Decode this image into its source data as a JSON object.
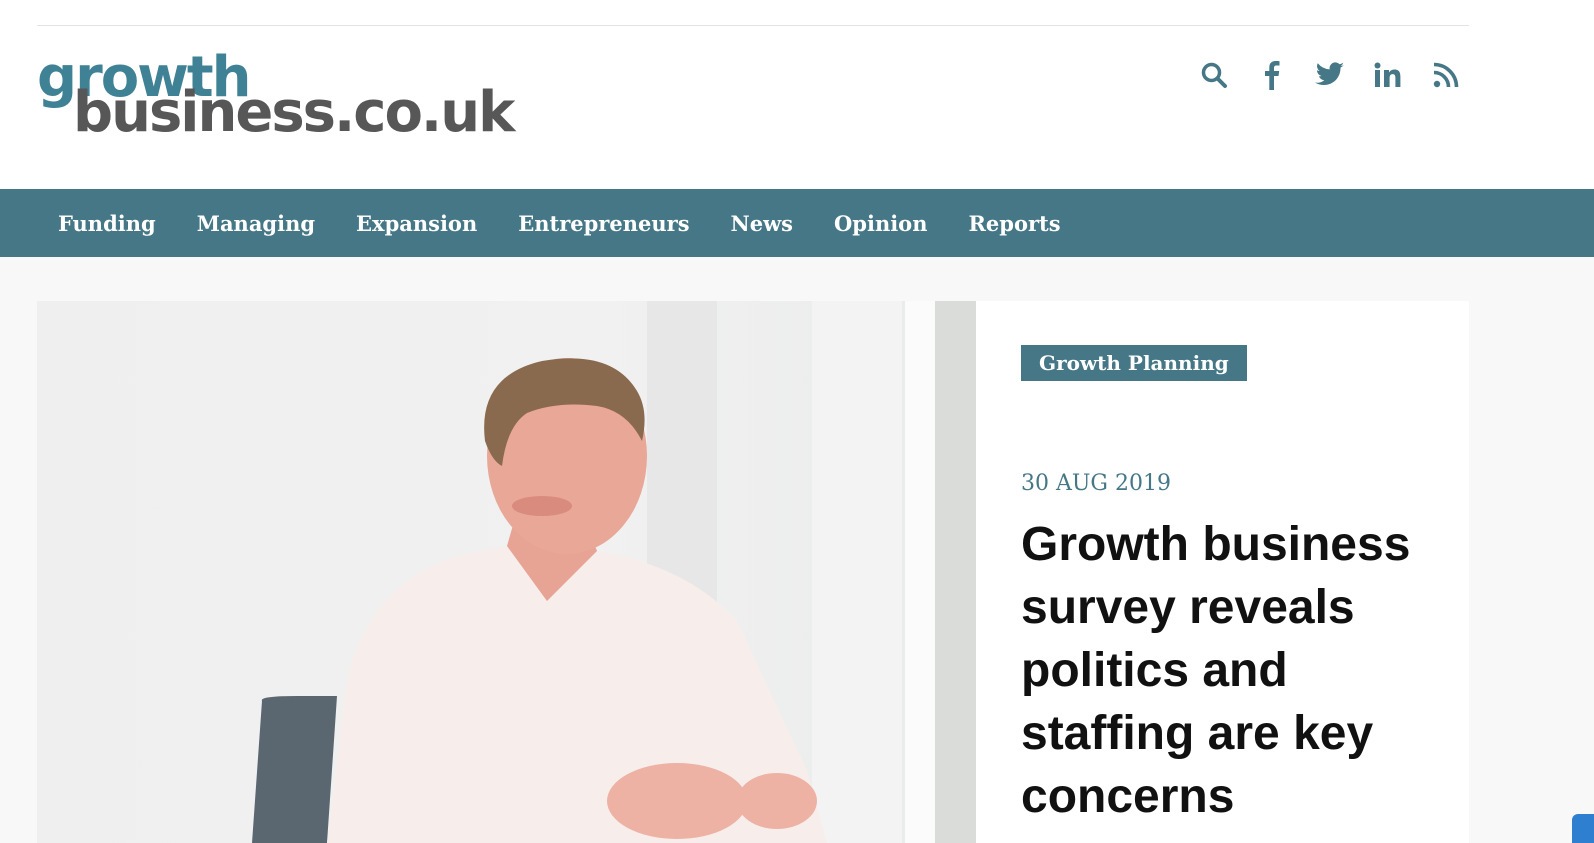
{
  "site": {
    "logo_line1": "growth",
    "logo_line2": "business.co.uk"
  },
  "header": {
    "social_icons": [
      "search-icon",
      "facebook-icon",
      "twitter-icon",
      "linkedin-icon",
      "rss-icon"
    ]
  },
  "nav": {
    "items": [
      {
        "label": "Funding"
      },
      {
        "label": "Managing"
      },
      {
        "label": "Expansion"
      },
      {
        "label": "Entrepreneurs"
      },
      {
        "label": "News"
      },
      {
        "label": "Opinion"
      },
      {
        "label": "Reports"
      }
    ]
  },
  "featured": {
    "category": "Growth Planning",
    "date": "30 AUG 2019",
    "headline": "Growth business survey reveals politics and staffing are key concerns"
  },
  "colors": {
    "brand_teal": "#457786",
    "logo_teal": "#3f8195",
    "logo_grey": "#575757"
  }
}
